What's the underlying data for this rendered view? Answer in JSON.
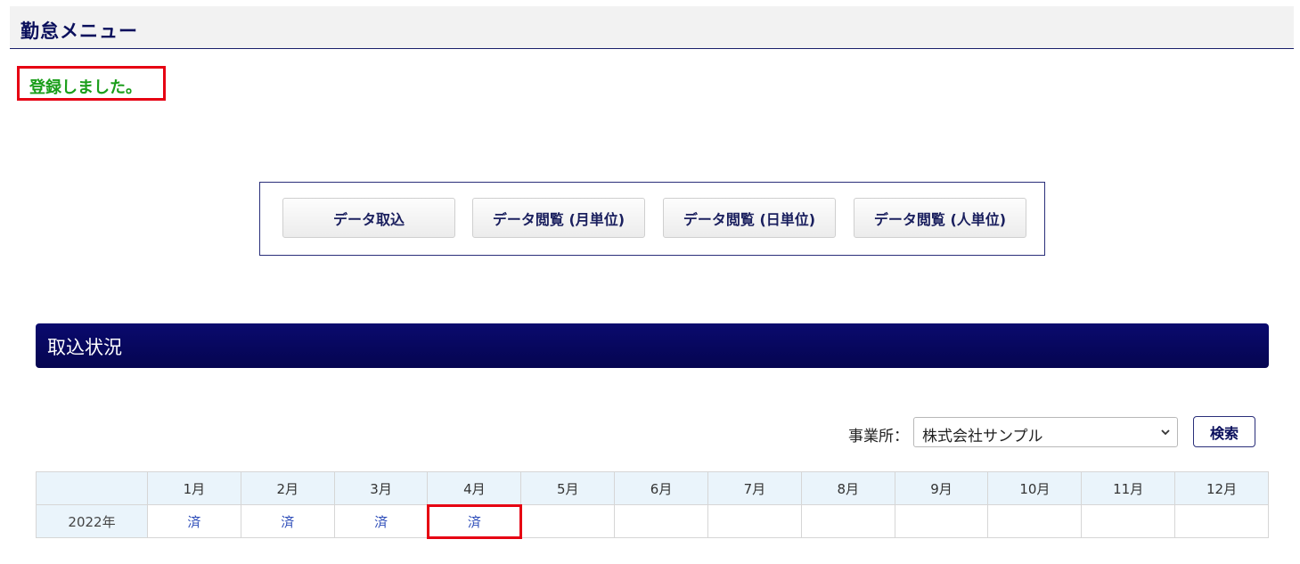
{
  "header": {
    "title": "勤怠メニュー"
  },
  "message": {
    "text": "登録しました。"
  },
  "menu": {
    "buttons": [
      {
        "label": "データ取込"
      },
      {
        "label": "データ閲覧 (月単位)"
      },
      {
        "label": "データ閲覧 (日単位)"
      },
      {
        "label": "データ閲覧 (人単位)"
      }
    ]
  },
  "section": {
    "title": "取込状況"
  },
  "filter": {
    "label": "事業所：",
    "selected": "株式会社サンプル",
    "search_label": "検索"
  },
  "table": {
    "corner": "",
    "months": [
      "1月",
      "2月",
      "3月",
      "4月",
      "5月",
      "6月",
      "7月",
      "8月",
      "9月",
      "10月",
      "11月",
      "12月"
    ],
    "rows": [
      {
        "year": "2022年",
        "cells": [
          "済",
          "済",
          "済",
          "済",
          "",
          "",
          "",
          "",
          "",
          "",
          "",
          ""
        ]
      }
    ]
  },
  "colors": {
    "header_navy": "#0a0f5c",
    "section_bar": "#050550",
    "success_green": "#1b9e1b",
    "highlight_red": "#e60012",
    "link_blue": "#2b4bb8",
    "table_header_bg": "#eaf4fb"
  },
  "icons": {
    "select_arrow": "chevron-down-icon"
  }
}
